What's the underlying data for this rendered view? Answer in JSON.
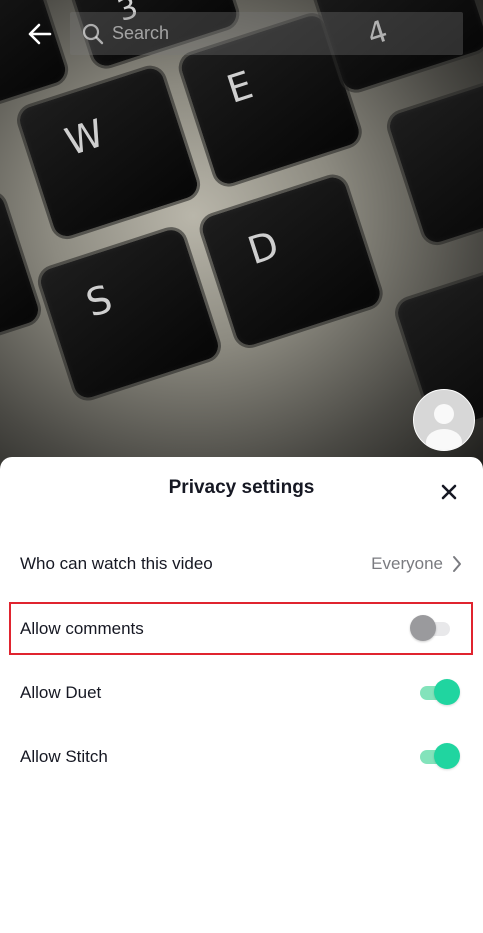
{
  "search": {
    "placeholder": "Search"
  },
  "sheet": {
    "title": "Privacy settings",
    "rows": [
      {
        "label": "Who can watch this video",
        "value": "Everyone"
      },
      {
        "label": "Allow comments",
        "enabled": false
      },
      {
        "label": "Allow Duet",
        "enabled": true
      },
      {
        "label": "Allow Stitch",
        "enabled": true
      }
    ]
  },
  "background_keys": [
    "W",
    "E",
    "S",
    "D",
    "#",
    "3",
    "$",
    "4"
  ],
  "colors": {
    "toggle_on": "#20d5a0",
    "toggle_off": "#9a9a9d",
    "highlight_border": "#e0242f",
    "text_primary": "#161823",
    "text_secondary": "#7a7b80"
  }
}
